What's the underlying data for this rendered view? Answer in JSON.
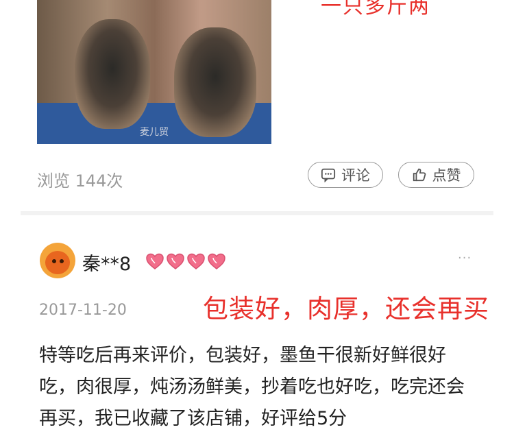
{
  "photo": {
    "watermark": "麦儿贸"
  },
  "top_overlay_text": "一只多斤两",
  "post_stats": {
    "views_label": "浏览 144次",
    "comment_label": "评论",
    "like_label": "点赞"
  },
  "review": {
    "username": "秦**8",
    "level_hearts": 4,
    "more_label": "···",
    "date": "2017-11-20",
    "caption": "包装好，肉厚，还会再买",
    "text": "特等吃后再来评价，包装好，墨鱼干很新好鲜很好吃，肉很厚，炖汤汤鲜美，抄着吃也好吃，吃完还会再买，我已收藏了该店铺，好评给5分"
  },
  "colors": {
    "accent_red": "#e8302b",
    "muted_gray": "#9a9a9a"
  }
}
